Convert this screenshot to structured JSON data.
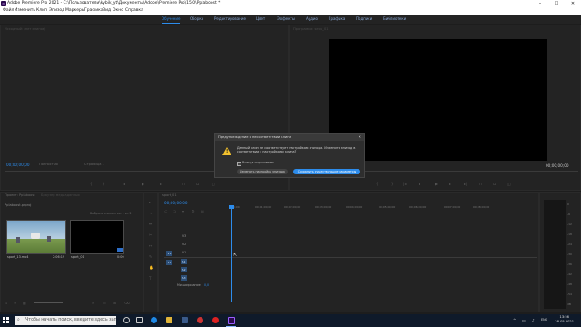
{
  "titlebar": {
    "app_logo": "Pr",
    "title": "Adobe Premiere Pro 2021 - C:\\Пользователи\\kybik_yt\\Документы\\Adobe\\Premiere Pro\\15.0\\Pplaboost *",
    "minimize": "–",
    "maximize": "☐",
    "close": "✕"
  },
  "menu": [
    "Файл",
    "Изменить",
    "Клип",
    "Эпизод",
    "Маркеры",
    "Графика",
    "Вид",
    "Окно",
    "Справка"
  ],
  "workspaces": {
    "items": [
      "Обучение",
      "Сборка",
      "Редактирование",
      "Цвет",
      "Эффекты",
      "Аудио",
      "Графика",
      "Подписи",
      "Библиотеки"
    ],
    "active_index": 0
  },
  "source_panel": {
    "title": "Исходный: (нет клипов)",
    "timecode": "00;00;00;00",
    "zoom": "Полностью",
    "page": "Страница 1"
  },
  "program_panel": {
    "title": "Программа: sequ_01",
    "timecode_left": "00;00;00;00",
    "timecode_right": "00;00;00;00"
  },
  "project_panel": {
    "tabs": [
      "Проект: Pplaboost",
      "Браузер медиаданных"
    ],
    "folder": "Pplaboost.prproj",
    "selected_info": "Выбрано элементов: 1 из 2",
    "items": [
      {
        "name": "sport_13.mp4",
        "duration": "2:06:19"
      },
      {
        "name": "sport_01",
        "duration": "0:00"
      }
    ]
  },
  "timeline_panel": {
    "tab": "sport_01",
    "timecode": "00;00;00;00",
    "ruler": [
      "00;00",
      "00;01;00;00",
      "00;02;00;00",
      "00;03;00;00",
      "00;04;00;00",
      "00;05;00;00",
      "00;06;00;00",
      "00;07;00;00",
      "00;08;00;00"
    ],
    "tracks_video": [
      "V3",
      "V2",
      "V1"
    ],
    "tracks_audio": [
      "A1",
      "A2",
      "A3"
    ],
    "master": "Микширование",
    "master_value": "0,0"
  },
  "audio_meter": {
    "ticks": [
      "0",
      "-6",
      "-12",
      "-18",
      "-24",
      "-30",
      "-36",
      "-42",
      "-48",
      "-54",
      "dB"
    ]
  },
  "dialog": {
    "title": "Предупреждение о несоответствии клипа",
    "message": "Данный клип не соответствует настройкам эпизода. Изменить эпизод в соответствии с настройками клипа?",
    "checkbox_label": "Всегда спрашивать",
    "keep_button": "Изменить настройки эпизода",
    "change_button": "Сохранить существующие параметры",
    "close": "✕"
  },
  "taskbar": {
    "search_placeholder": "Чтобы начать поиск, введите здесь запрос",
    "time": "13:56",
    "date": "28.05.2021",
    "lang": "ENG"
  },
  "colors": {
    "accent": "#2d8ceb",
    "warning": "#f2c12e"
  }
}
